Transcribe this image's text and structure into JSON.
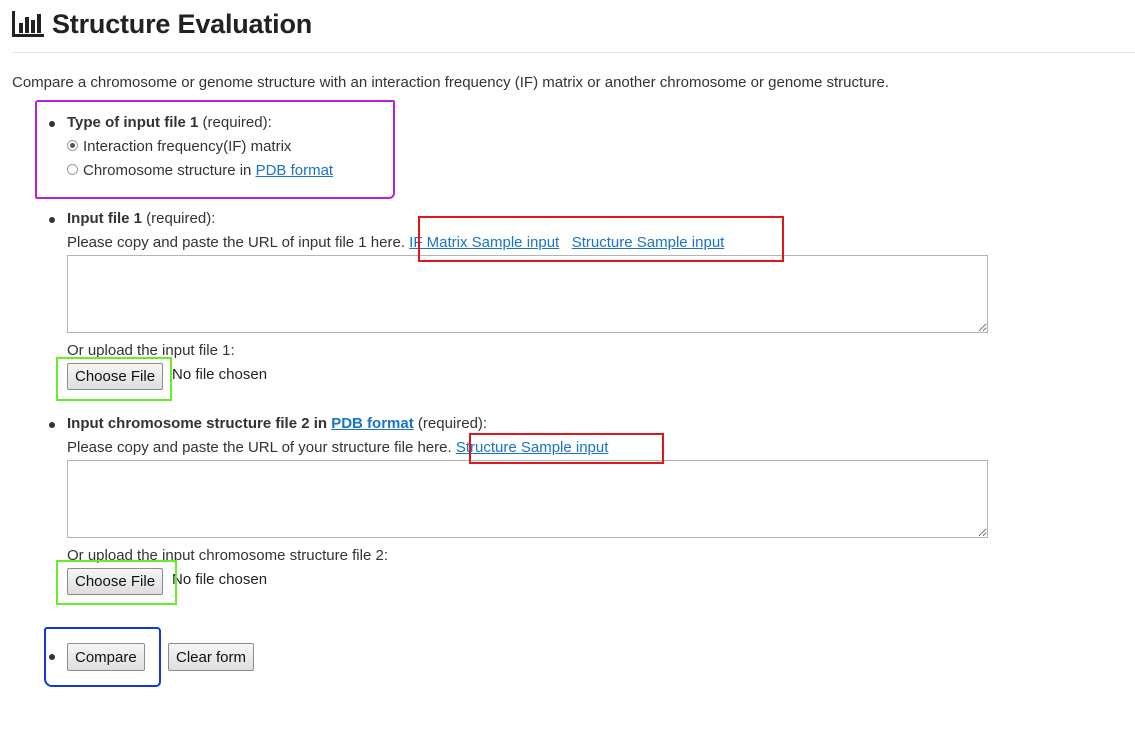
{
  "header": {
    "icon": "bar-chart-icon",
    "title": "Structure Evaluation"
  },
  "intro": "Compare a chromosome or genome structure with an interaction frequency (IF) matrix or another chromosome or genome structure.",
  "section1": {
    "label_bold": "Type of input file 1",
    "label_rest": " (required):",
    "options": [
      {
        "label": "Interaction frequency(IF) matrix",
        "checked": true
      },
      {
        "label_prefix": "Chromosome structure in ",
        "link": "PDB format",
        "checked": false
      }
    ]
  },
  "section2": {
    "label_bold": "Input file 1",
    "label_rest": " (required):",
    "instruction": "Please copy and paste the URL of input file 1 here.",
    "link1": "IF Matrix Sample input",
    "link2": "Structure Sample input",
    "upload_label": "Or upload the input file 1:",
    "choose_file": "Choose File",
    "no_file": "No file chosen"
  },
  "section3": {
    "label_bold": "Input chromosome structure file 2 in ",
    "label_link": "PDB format",
    "label_rest": " (required):",
    "instruction": "Please copy and paste the URL of your structure file here.",
    "link": "Structure Sample input",
    "upload_label": "Or upload the input chromosome structure file 2:",
    "choose_file": "Choose File",
    "no_file": "No file chosen"
  },
  "actions": {
    "compare": "Compare",
    "clear": "Clear form"
  },
  "colors": {
    "link": "#1a73c7",
    "annotation_purple": "#b620e0",
    "annotation_red": "#e0161b",
    "annotation_green": "#66ee2a",
    "annotation_blue": "#1138d8"
  }
}
